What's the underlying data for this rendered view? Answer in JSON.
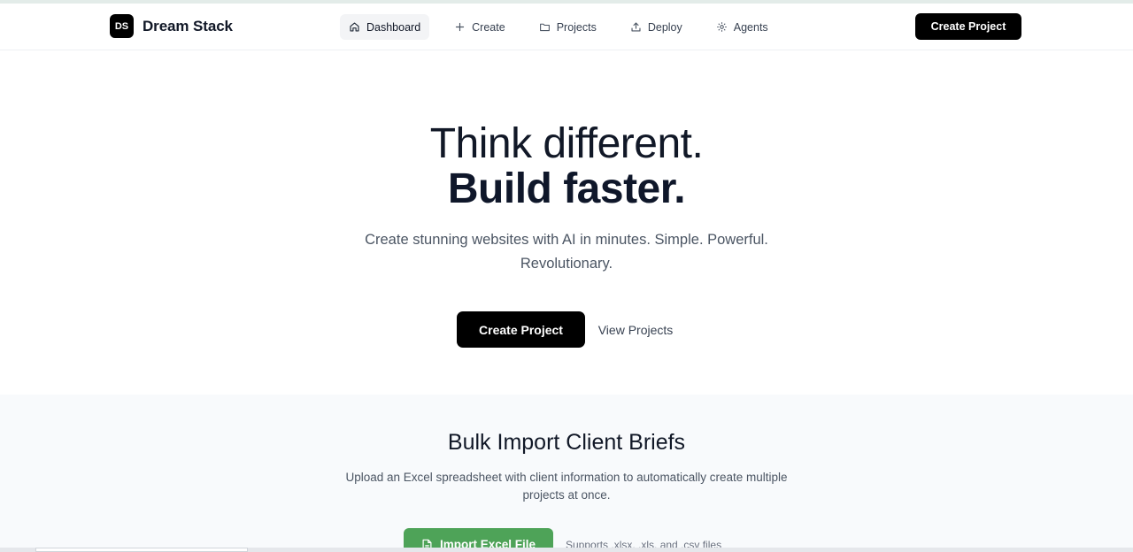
{
  "brand": {
    "logo_text": "DS",
    "name": "Dream Stack"
  },
  "nav": {
    "items": [
      {
        "label": "Dashboard",
        "icon": "home-icon",
        "active": true
      },
      {
        "label": "Create",
        "icon": "plus-icon",
        "active": false
      },
      {
        "label": "Projects",
        "icon": "folder-icon",
        "active": false
      },
      {
        "label": "Deploy",
        "icon": "upload-icon",
        "active": false
      },
      {
        "label": "Agents",
        "icon": "gear-icon",
        "active": false
      }
    ],
    "cta_label": "Create Project"
  },
  "hero": {
    "headline_line1": "Think different.",
    "headline_line2": "Build faster.",
    "subtitle": "Create stunning websites with AI in minutes. Simple. Powerful. Revolutionary.",
    "primary_button": "Create Project",
    "secondary_link": "View Projects"
  },
  "bulk_import": {
    "title": "Bulk Import Client Briefs",
    "description": "Upload an Excel spreadsheet with client information to automatically create multiple projects at once.",
    "button_label": "Import Excel File",
    "button_icon": "file-icon",
    "support_text": "Supports .xlsx, .xls, and .csv files"
  },
  "colors": {
    "primary": "#000000",
    "import_button": "#4ea358",
    "section_bg": "#f8fafc"
  }
}
